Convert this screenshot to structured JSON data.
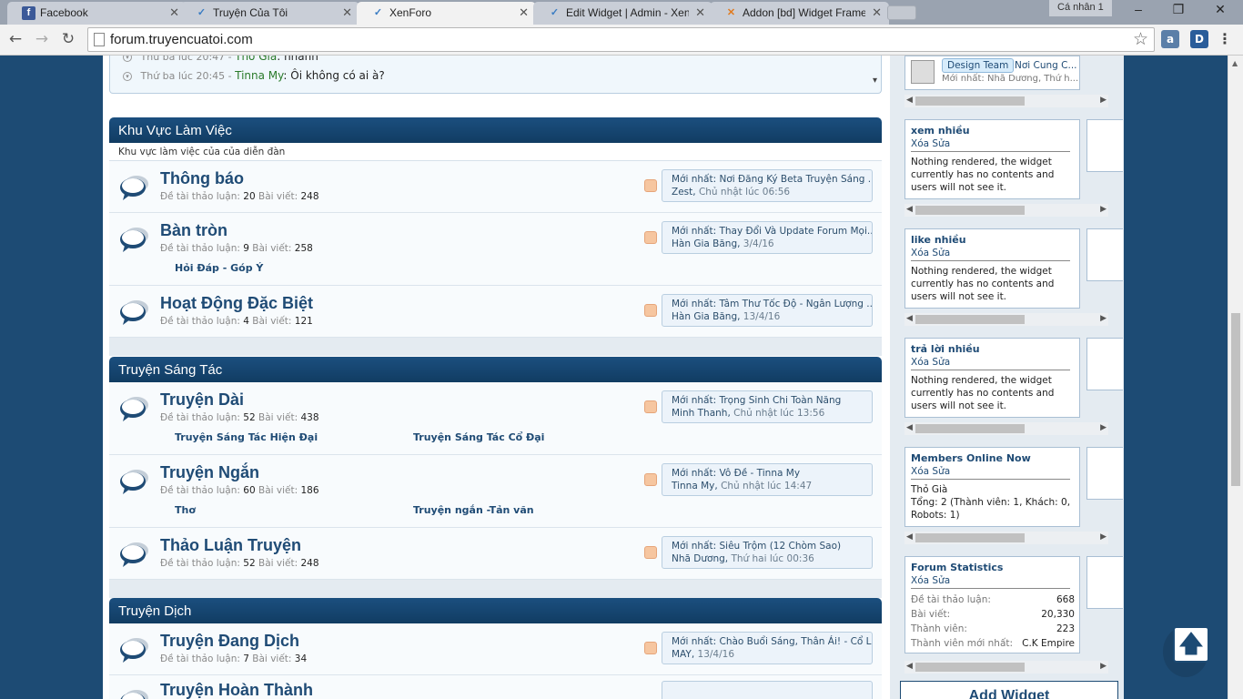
{
  "browser": {
    "tabs": [
      {
        "label": "Facebook",
        "icon": "facebook-icon",
        "active": false
      },
      {
        "label": "Truyện Của Tôi",
        "icon": "xenforo-icon",
        "active": false
      },
      {
        "label": "XenForo",
        "icon": "xenforo-icon",
        "active": true
      },
      {
        "label": "Edit Widget | Admin - Xen",
        "icon": "xenforo-icon",
        "active": false
      },
      {
        "label": "Addon [bd] Widget Frame",
        "icon": "addon-icon",
        "active": false
      }
    ],
    "profile": "Cá nhân 1",
    "window_controls": {
      "minimize": "–",
      "restore": "❐",
      "close": "✕"
    },
    "nav": {
      "back": "←",
      "forward": "→",
      "reload": "↻"
    },
    "url": "forum.truyencuatoi.com",
    "star": "☆",
    "extensions": [
      {
        "label": "a"
      },
      {
        "label": "D"
      },
      {
        "label": "⋮"
      }
    ]
  },
  "shoutbox": {
    "rows": [
      {
        "time": "Thứ ba lúc 20:47 -",
        "name": "Thỏ Già",
        "message": "nhanh"
      },
      {
        "time": "Thứ ba lúc 20:45 -",
        "name": "Tinna My",
        "message": "Ôi không có ai à?"
      }
    ],
    "scroll_arrow": "▾"
  },
  "categories": [
    {
      "title": "Khu Vực Làm Việc",
      "description": "Khu vực làm việc của của diễn đàn",
      "nodes": [
        {
          "title": "Thông báo",
          "threads_label": "Đề tài thảo luận:",
          "threads": "20",
          "posts_label": "Bài viết:",
          "posts": "248",
          "latest_prefix": "Mới nhất:",
          "latest_title": "Nơi Đăng Ký Beta Truyện Sáng ...",
          "latest_user": "Zest",
          "latest_date": "Chủ nhật lúc 06:56",
          "subforums": []
        },
        {
          "title": "Bàn tròn",
          "threads_label": "Đề tài thảo luận:",
          "threads": "9",
          "posts_label": "Bài viết:",
          "posts": "258",
          "latest_prefix": "Mới nhất:",
          "latest_title": "Thay Đổi Và Update Forum Mọi...",
          "latest_user": "Hàn Gia Băng",
          "latest_date": "3/4/16",
          "subforums": [
            "Hỏi Đáp - Góp Ý"
          ]
        },
        {
          "title": "Hoạt Động Đặc Biệt",
          "threads_label": "Đề tài thảo luận:",
          "threads": "4",
          "posts_label": "Bài viết:",
          "posts": "121",
          "latest_prefix": "Mới nhất:",
          "latest_title": "Tâm Thư Tốc Độ - Ngân Lượng ...",
          "latest_user": "Hàn Gia Băng",
          "latest_date": "13/4/16",
          "subforums": []
        }
      ]
    },
    {
      "title": "Truyện Sáng Tác",
      "description": "",
      "nodes": [
        {
          "title": "Truyện Dài",
          "threads_label": "Đề tài thảo luận:",
          "threads": "52",
          "posts_label": "Bài viết:",
          "posts": "438",
          "latest_prefix": "Mới nhất:",
          "latest_title": "Trọng Sinh Chi Toàn Năng",
          "latest_user": "Minh Thanh",
          "latest_date": "Chủ nhật lúc 13:56",
          "subforums": [
            "Truyện Sáng Tác Hiện Đại",
            "Truyện Sáng Tác Cổ Đại"
          ]
        },
        {
          "title": "Truyện Ngắn",
          "threads_label": "Đề tài thảo luận:",
          "threads": "60",
          "posts_label": "Bài viết:",
          "posts": "186",
          "latest_prefix": "Mới nhất:",
          "latest_title": "Vô Đề - Tinna My",
          "latest_user": "Tinna My",
          "latest_date": "Chủ nhật lúc 14:47",
          "subforums": [
            "Thơ",
            "Truyện ngắn -Tản văn"
          ]
        },
        {
          "title": "Thảo Luận Truyện",
          "threads_label": "Đề tài thảo luận:",
          "threads": "52",
          "posts_label": "Bài viết:",
          "posts": "248",
          "latest_prefix": "Mới nhất:",
          "latest_title": "Siêu Trộm (12 Chòm Sao)",
          "latest_user": "Nhã Dương",
          "latest_date": "Thứ hai lúc 00:36",
          "subforums": []
        }
      ]
    },
    {
      "title": "Truyện Dịch",
      "description": "",
      "nodes": [
        {
          "title": "Truyện Đang Dịch",
          "threads_label": "Đề tài thảo luận:",
          "threads": "7",
          "posts_label": "Bài viết:",
          "posts": "34",
          "latest_prefix": "Mới nhất:",
          "latest_title": "Chào Buổi Sáng, Thân Ái! - Cổ L...",
          "latest_user": "MAY",
          "latest_date": "13/4/16",
          "subforums": []
        },
        {
          "title": "Truyện Hoàn Thành",
          "threads_label": "",
          "threads": "",
          "posts_label": "",
          "posts": "",
          "latest_prefix": "",
          "latest_title": "",
          "latest_user": "",
          "latest_date": "",
          "subforums": []
        }
      ]
    }
  ],
  "sidebar": {
    "top_widget": {
      "tag": "Design Team",
      "text": "Nơi Cung C...",
      "latest": "Mới nhất: Nhã Dương, Thứ h..."
    },
    "widgets": [
      {
        "title": "xem nhiều",
        "edit": "Xóa Sửa",
        "body": "Nothing rendered, the widget currently has no contents and users will not see it."
      },
      {
        "title": "like nhiều",
        "edit": "Xóa Sửa",
        "body": "Nothing rendered, the widget currently has no contents and users will not see it."
      },
      {
        "title": "trả lời nhiều",
        "edit": "Xóa Sửa",
        "body": "Nothing rendered, the widget currently has no contents and users will not see it."
      },
      {
        "title": "Members Online Now",
        "edit": "Xóa Sửa",
        "body": "Thỏ Già\nTổng: 2 (Thành viên: 1, Khách: 0, Robots: 1)"
      }
    ],
    "stats": {
      "title": "Forum Statistics",
      "edit": "Xóa Sửa",
      "rows": [
        {
          "label": "Đề tài thảo luận:",
          "value": "668"
        },
        {
          "label": "Bài viết:",
          "value": "20,330"
        },
        {
          "label": "Thành viên:",
          "value": "223"
        },
        {
          "label": "Thành viên mới nhất:",
          "value": "C.K Empire"
        }
      ]
    },
    "add_widget": "Add Widget",
    "arrows": {
      "left": "◀",
      "right": "▶"
    }
  },
  "back_to_top": "🡅"
}
